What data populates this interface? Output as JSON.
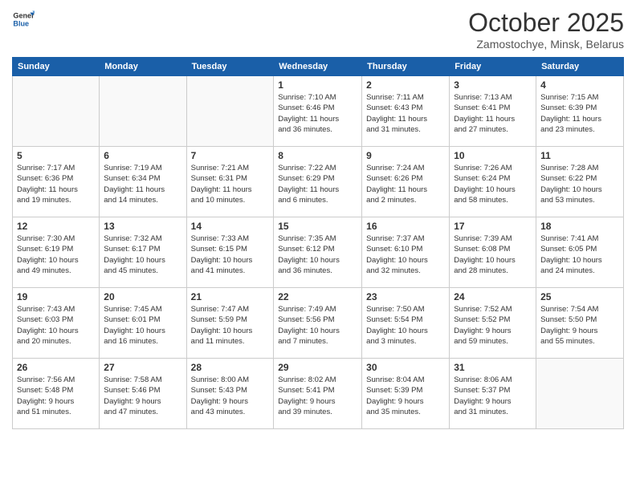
{
  "logo": {
    "general": "General",
    "blue": "Blue"
  },
  "header": {
    "month": "October 2025",
    "location": "Zamostochye, Minsk, Belarus"
  },
  "weekdays": [
    "Sunday",
    "Monday",
    "Tuesday",
    "Wednesday",
    "Thursday",
    "Friday",
    "Saturday"
  ],
  "weeks": [
    [
      {
        "day": "",
        "info": ""
      },
      {
        "day": "",
        "info": ""
      },
      {
        "day": "",
        "info": ""
      },
      {
        "day": "1",
        "info": "Sunrise: 7:10 AM\nSunset: 6:46 PM\nDaylight: 11 hours\nand 36 minutes."
      },
      {
        "day": "2",
        "info": "Sunrise: 7:11 AM\nSunset: 6:43 PM\nDaylight: 11 hours\nand 31 minutes."
      },
      {
        "day": "3",
        "info": "Sunrise: 7:13 AM\nSunset: 6:41 PM\nDaylight: 11 hours\nand 27 minutes."
      },
      {
        "day": "4",
        "info": "Sunrise: 7:15 AM\nSunset: 6:39 PM\nDaylight: 11 hours\nand 23 minutes."
      }
    ],
    [
      {
        "day": "5",
        "info": "Sunrise: 7:17 AM\nSunset: 6:36 PM\nDaylight: 11 hours\nand 19 minutes."
      },
      {
        "day": "6",
        "info": "Sunrise: 7:19 AM\nSunset: 6:34 PM\nDaylight: 11 hours\nand 14 minutes."
      },
      {
        "day": "7",
        "info": "Sunrise: 7:21 AM\nSunset: 6:31 PM\nDaylight: 11 hours\nand 10 minutes."
      },
      {
        "day": "8",
        "info": "Sunrise: 7:22 AM\nSunset: 6:29 PM\nDaylight: 11 hours\nand 6 minutes."
      },
      {
        "day": "9",
        "info": "Sunrise: 7:24 AM\nSunset: 6:26 PM\nDaylight: 11 hours\nand 2 minutes."
      },
      {
        "day": "10",
        "info": "Sunrise: 7:26 AM\nSunset: 6:24 PM\nDaylight: 10 hours\nand 58 minutes."
      },
      {
        "day": "11",
        "info": "Sunrise: 7:28 AM\nSunset: 6:22 PM\nDaylight: 10 hours\nand 53 minutes."
      }
    ],
    [
      {
        "day": "12",
        "info": "Sunrise: 7:30 AM\nSunset: 6:19 PM\nDaylight: 10 hours\nand 49 minutes."
      },
      {
        "day": "13",
        "info": "Sunrise: 7:32 AM\nSunset: 6:17 PM\nDaylight: 10 hours\nand 45 minutes."
      },
      {
        "day": "14",
        "info": "Sunrise: 7:33 AM\nSunset: 6:15 PM\nDaylight: 10 hours\nand 41 minutes."
      },
      {
        "day": "15",
        "info": "Sunrise: 7:35 AM\nSunset: 6:12 PM\nDaylight: 10 hours\nand 36 minutes."
      },
      {
        "day": "16",
        "info": "Sunrise: 7:37 AM\nSunset: 6:10 PM\nDaylight: 10 hours\nand 32 minutes."
      },
      {
        "day": "17",
        "info": "Sunrise: 7:39 AM\nSunset: 6:08 PM\nDaylight: 10 hours\nand 28 minutes."
      },
      {
        "day": "18",
        "info": "Sunrise: 7:41 AM\nSunset: 6:05 PM\nDaylight: 10 hours\nand 24 minutes."
      }
    ],
    [
      {
        "day": "19",
        "info": "Sunrise: 7:43 AM\nSunset: 6:03 PM\nDaylight: 10 hours\nand 20 minutes."
      },
      {
        "day": "20",
        "info": "Sunrise: 7:45 AM\nSunset: 6:01 PM\nDaylight: 10 hours\nand 16 minutes."
      },
      {
        "day": "21",
        "info": "Sunrise: 7:47 AM\nSunset: 5:59 PM\nDaylight: 10 hours\nand 11 minutes."
      },
      {
        "day": "22",
        "info": "Sunrise: 7:49 AM\nSunset: 5:56 PM\nDaylight: 10 hours\nand 7 minutes."
      },
      {
        "day": "23",
        "info": "Sunrise: 7:50 AM\nSunset: 5:54 PM\nDaylight: 10 hours\nand 3 minutes."
      },
      {
        "day": "24",
        "info": "Sunrise: 7:52 AM\nSunset: 5:52 PM\nDaylight: 9 hours\nand 59 minutes."
      },
      {
        "day": "25",
        "info": "Sunrise: 7:54 AM\nSunset: 5:50 PM\nDaylight: 9 hours\nand 55 minutes."
      }
    ],
    [
      {
        "day": "26",
        "info": "Sunrise: 7:56 AM\nSunset: 5:48 PM\nDaylight: 9 hours\nand 51 minutes."
      },
      {
        "day": "27",
        "info": "Sunrise: 7:58 AM\nSunset: 5:46 PM\nDaylight: 9 hours\nand 47 minutes."
      },
      {
        "day": "28",
        "info": "Sunrise: 8:00 AM\nSunset: 5:43 PM\nDaylight: 9 hours\nand 43 minutes."
      },
      {
        "day": "29",
        "info": "Sunrise: 8:02 AM\nSunset: 5:41 PM\nDaylight: 9 hours\nand 39 minutes."
      },
      {
        "day": "30",
        "info": "Sunrise: 8:04 AM\nSunset: 5:39 PM\nDaylight: 9 hours\nand 35 minutes."
      },
      {
        "day": "31",
        "info": "Sunrise: 8:06 AM\nSunset: 5:37 PM\nDaylight: 9 hours\nand 31 minutes."
      },
      {
        "day": "",
        "info": ""
      }
    ]
  ]
}
